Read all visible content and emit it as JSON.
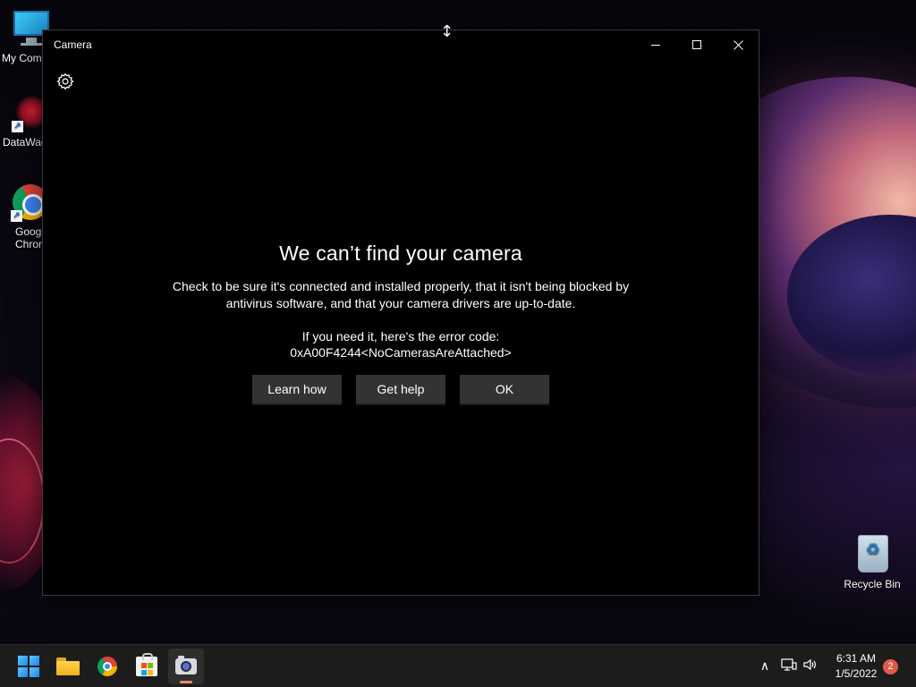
{
  "desktop": {
    "icons": [
      {
        "label": "My Com",
        "icon": "computer-icon"
      },
      {
        "label": "DataWag",
        "icon": "datawag-icon"
      },
      {
        "label": "Goog\nChron",
        "icon": "chrome-icon"
      },
      {
        "label": "Recycle Bin",
        "icon": "recycle-bin-icon"
      }
    ]
  },
  "window": {
    "title": "Camera",
    "controls": {
      "minimize": "minimize-icon",
      "maximize": "maximize-icon",
      "close": "close-icon"
    },
    "settings_icon": "gear-icon"
  },
  "error": {
    "title": "We can’t find your camera",
    "body": "Check to be sure it's connected and installed properly, that it isn't being blocked by antivirus software, and that your camera drivers are up-to-date.",
    "code_label": "If you need it, here's the error code:",
    "code": "0xA00F4244<NoCamerasAreAttached>",
    "buttons": {
      "learn_how": "Learn how",
      "get_help": "Get help",
      "ok": "OK"
    }
  },
  "cursor": "↕",
  "taskbar": {
    "items": [
      "start-icon",
      "file-explorer-icon",
      "chrome-icon",
      "microsoft-store-icon",
      "camera-app-icon"
    ],
    "active": "camera-app-icon",
    "tray": {
      "chevron": "∧",
      "network": "▭",
      "volume": "🔈"
    },
    "time": "6:31 AM",
    "date": "1/5/2022",
    "notifications": "2"
  },
  "colors": {
    "window_bg": "#000000",
    "button_bg": "#333333",
    "taskbar_bg": "#1c1c1c",
    "active_indicator": "#e88a6a",
    "badge": "#e05a4a"
  }
}
